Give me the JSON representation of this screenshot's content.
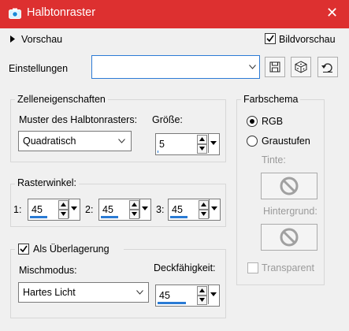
{
  "window": {
    "title": "Halbtonraster",
    "close_glyph": "✕",
    "colors": {
      "titlebar": "#dd3030",
      "accent": "#2a7bd4"
    }
  },
  "top": {
    "preview_label": "Vorschau",
    "bild_preview_label": "Bildvorschau",
    "bild_preview_checked": true,
    "settings_label": "Einstellungen",
    "settings_value": "",
    "icons": [
      "save-icon",
      "randomize-dice-icon",
      "reset-icon"
    ]
  },
  "cell_props": {
    "legend": "Zelleneigenschaften",
    "pattern_label": "Muster des Halbtonrasters:",
    "pattern_value": "Quadratisch",
    "size_label": "Größe:",
    "size_value": "5"
  },
  "raster": {
    "legend": "Rasterwinkel:",
    "channels": [
      {
        "label": "1:",
        "value": "45"
      },
      {
        "label": "2:",
        "value": "45"
      },
      {
        "label": "3:",
        "value": "45"
      }
    ]
  },
  "overlay": {
    "label": "Als Überlagerung",
    "checked": true,
    "blend_label": "Mischmodus:",
    "blend_value": "Hartes Licht",
    "opacity_label": "Deckfähigkeit:",
    "opacity_value": "45"
  },
  "color_scheme": {
    "legend": "Farbschema",
    "options": [
      {
        "label": "RGB",
        "selected": true
      },
      {
        "label": "Graustufen",
        "selected": false
      }
    ],
    "ink_label": "Tinte:",
    "background_label": "Hintergrund:",
    "transparent_label": "Transparent",
    "transparent_checked": false
  }
}
